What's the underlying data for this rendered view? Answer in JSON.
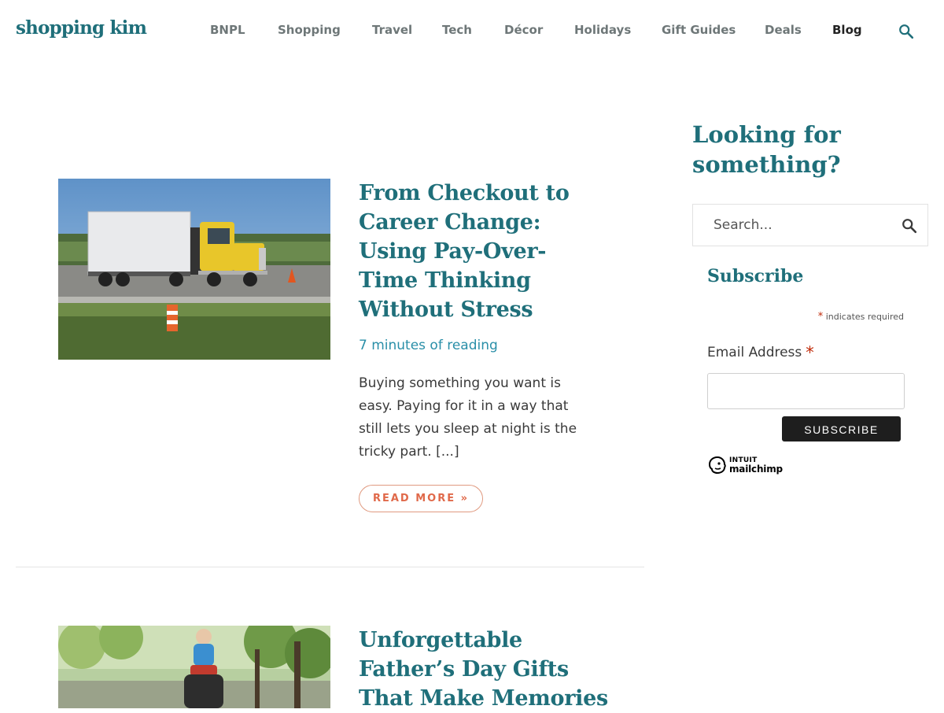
{
  "site": {
    "logo_text": "shopping kim",
    "brand_color": "#1f6f7a",
    "accent_color": "#e0694a"
  },
  "nav": {
    "items": [
      {
        "label": "BNPL",
        "active": false
      },
      {
        "label": "Shopping",
        "active": false
      },
      {
        "label": "Travel",
        "active": false
      },
      {
        "label": "Tech",
        "active": false
      },
      {
        "label": "Décor",
        "active": false
      },
      {
        "label": "Holidays",
        "active": false
      },
      {
        "label": "Gift Guides",
        "active": false
      },
      {
        "label": "Deals",
        "active": false
      },
      {
        "label": "Blog",
        "active": true
      }
    ],
    "search_icon": "search-icon"
  },
  "posts": [
    {
      "image_subject": "yellow semi-truck on highway",
      "title": "From Checkout to Career Change: Using Pay-Over-Time Thinking Without Stress",
      "reading_time": "7 minutes of reading",
      "excerpt": "Buying something you want is easy. Paying for it in a way that still lets you sleep at night is the tricky part. [...]",
      "read_more": "READ MORE »"
    },
    {
      "image_subject": "father carrying child on shoulders in park",
      "title": "Unforgettable Father’s Day Gifts That Make Memories"
    }
  ],
  "sidebar": {
    "heading": "Looking for something?",
    "search_placeholder": "Search...",
    "subscribe": {
      "heading": "Subscribe",
      "required_star": "*",
      "required_note": "indicates required",
      "email_label": "Email Address",
      "email_required_star": "*",
      "email_value": "",
      "button_label": "SUBSCRIBE",
      "badge_line1": "INTUIT",
      "badge_line2": "mailchimp"
    }
  }
}
